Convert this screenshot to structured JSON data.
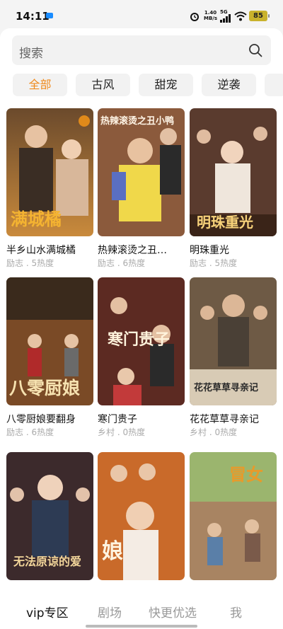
{
  "status": {
    "time": "14:11",
    "net_speed_top": "1.40",
    "net_speed_bottom": "MB/s",
    "signal_label": "5G",
    "battery": "85"
  },
  "search": {
    "placeholder": "搜索"
  },
  "categories": [
    "全部",
    "古风",
    "甜宠",
    "逆袭"
  ],
  "cards": [
    {
      "title": "半乡山水满城橘",
      "meta": "励志 . 5热度",
      "poster_text": "满城橘"
    },
    {
      "title": "热辣滚烫之丑…",
      "meta": "励志 . 6热度",
      "poster_text": "热辣滚烫之丑小鸭"
    },
    {
      "title": "明珠重光",
      "meta": "励志 . 5热度",
      "poster_text": "明珠重光"
    },
    {
      "title": "八零厨娘要翻身",
      "meta": "励志 . 6热度",
      "poster_text": "八零厨娘"
    },
    {
      "title": "寒门贵子",
      "meta": "乡村 . 0热度",
      "poster_text": "寒门贵子"
    },
    {
      "title": "花花草草寻亲记",
      "meta": "乡村 . 0热度",
      "poster_text": "花花草草寻亲记"
    },
    {
      "title": "",
      "meta": "",
      "poster_text": "无法原谅的爱"
    },
    {
      "title": "",
      "meta": "",
      "poster_text": "娘"
    },
    {
      "title": "",
      "meta": "",
      "poster_text": "冒女"
    }
  ],
  "nav": [
    "vip专区",
    "剧场",
    "快更优选",
    "我"
  ],
  "colors": {
    "accent": "#f08a1c",
    "chip_bg": "#f2f2f2",
    "battery": "#c9b22c"
  }
}
